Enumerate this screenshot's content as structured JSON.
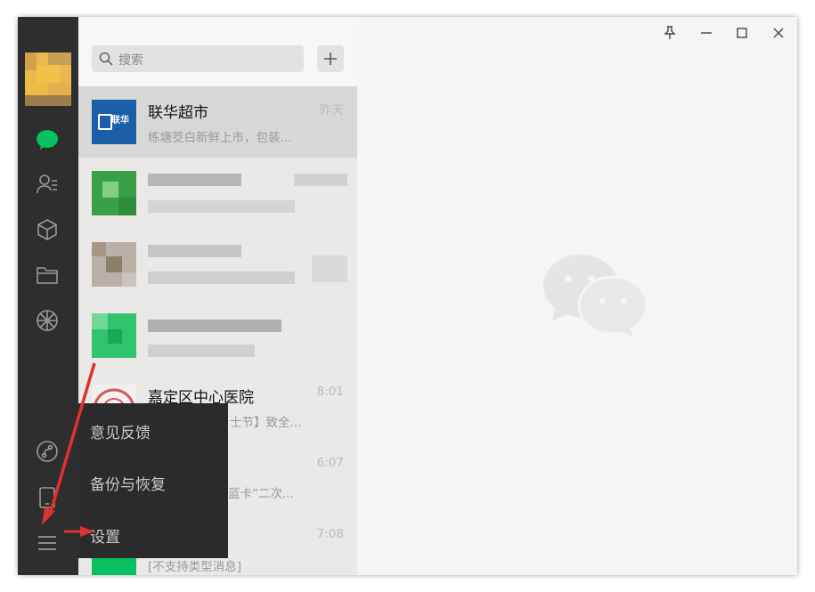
{
  "search": {
    "placeholder": "搜索"
  },
  "sidebar": {
    "icons": [
      "chat-icon",
      "contacts-icon",
      "favorites-icon",
      "files-icon",
      "moments-icon",
      "mini-program-icon",
      "phone-icon",
      "menu-icon"
    ]
  },
  "chats": [
    {
      "name": "联华超市",
      "preview": "练塘茭白新鲜上市，包装...",
      "time": "昨天",
      "logo_text": "联华"
    },
    {
      "name": "",
      "preview": "",
      "time": ""
    },
    {
      "name": "",
      "preview": "",
      "time": ""
    },
    {
      "name": "",
      "preview": "",
      "time": ""
    },
    {
      "name": "嘉定区中心医院",
      "preview": "士节】致全...",
      "time": "8:01"
    },
    {
      "name": "",
      "preview": "蓝卡”二次...",
      "time": "6:07"
    },
    {
      "name": "",
      "preview": "[不支持类型消息]",
      "time": "7:08"
    }
  ],
  "menu": {
    "items": [
      "意见反馈",
      "备份与恢复",
      "设置"
    ]
  },
  "window_controls": [
    "pin-icon",
    "minimize-icon",
    "maximize-icon",
    "close-icon"
  ],
  "colors": {
    "sidebar_bg": "#2e2e2e",
    "accent_green": "#07c160",
    "annotation_red": "#e03030"
  }
}
